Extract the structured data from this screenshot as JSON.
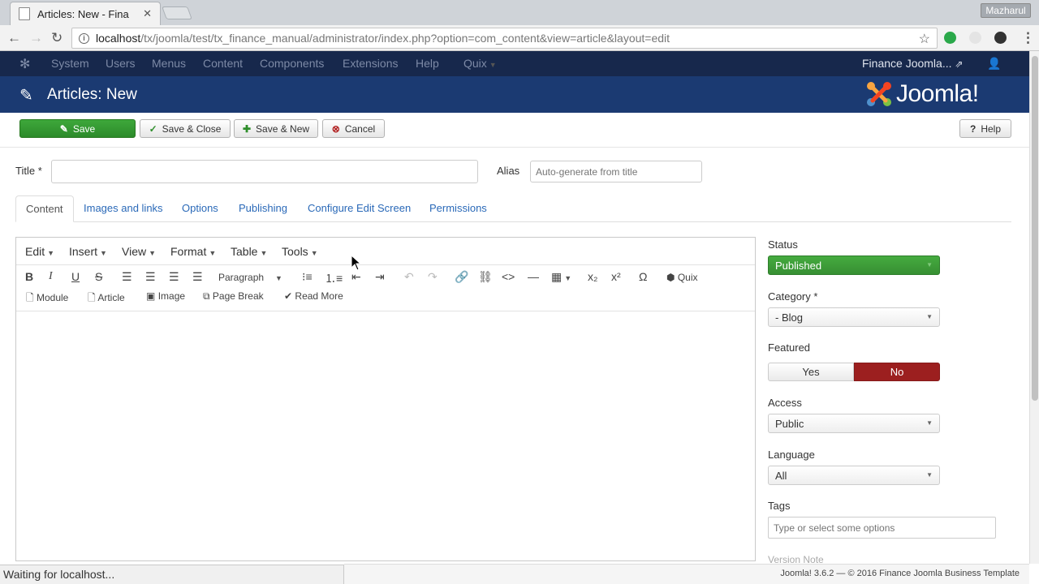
{
  "browser": {
    "tab_title": "Articles: New - Fina",
    "user_badge": "Mazharul",
    "url_host": "localhost",
    "url_path": "/tx/joomla/test/tx_finance_manual/administrator/index.php?option=com_content&view=article&layout=edit",
    "status_text": "Waiting for localhost..."
  },
  "jnav": {
    "items": [
      "System",
      "Users",
      "Menus",
      "Content",
      "Components",
      "Extensions",
      "Help",
      "Quix"
    ],
    "site_name": "Finance Joomla..."
  },
  "header": {
    "title": "Articles: New",
    "logo_text": "Joomla!"
  },
  "toolbar": {
    "save": "Save",
    "save_close": "Save & Close",
    "save_new": "Save & New",
    "cancel": "Cancel",
    "help": "Help"
  },
  "form": {
    "title_label": "Title *",
    "title_value": "",
    "alias_label": "Alias",
    "alias_placeholder": "Auto-generate from title"
  },
  "tabs": [
    "Content",
    "Images and links",
    "Options",
    "Publishing",
    "Configure Edit Screen",
    "Permissions"
  ],
  "editor": {
    "menus": [
      "Edit",
      "Insert",
      "View",
      "Format",
      "Table",
      "Tools"
    ],
    "format_select": "Paragraph",
    "quix_label": "Quix",
    "buttons": [
      "Module",
      "Article",
      "Image",
      "Page Break",
      "Read More"
    ]
  },
  "sidebar": {
    "status_label": "Status",
    "status_value": "Published",
    "category_label": "Category *",
    "category_value": "- Blog",
    "featured_label": "Featured",
    "featured_yes": "Yes",
    "featured_no": "No",
    "access_label": "Access",
    "access_value": "Public",
    "language_label": "Language",
    "language_value": "All",
    "tags_label": "Tags",
    "tags_placeholder": "Type or select some options",
    "version_note_label": "Version Note"
  },
  "footer": {
    "text": "Joomla! 3.6.2  —  © 2016 Finance Joomla Business Template"
  },
  "colors": {
    "nav_bg": "#17284c",
    "header_bg": "#1b3a72",
    "save_green": "#2f8f2c",
    "featured_no_red": "#9c1f1f",
    "link_blue": "#2a69b8"
  }
}
